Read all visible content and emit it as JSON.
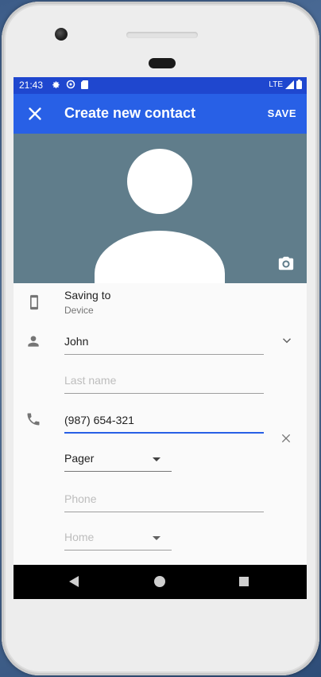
{
  "status_bar": {
    "time": "21:43",
    "network": "LTE",
    "icons": [
      "settings-icon",
      "sync-icon",
      "sd-card-icon",
      "signal-icon",
      "battery-icon"
    ]
  },
  "app_bar": {
    "title": "Create new contact",
    "save_label": "SAVE",
    "close_icon": "close-icon"
  },
  "photo": {
    "background_color": "#607d8b",
    "camera_icon": "camera-icon"
  },
  "saving_to": {
    "label": "Saving to",
    "account": "Device",
    "icon": "phone-device-icon"
  },
  "name": {
    "icon": "person-icon",
    "first_name_value": "John",
    "last_name_placeholder": "Last name",
    "expand_icon": "chevron-down-icon"
  },
  "phone": {
    "icon": "phone-icon",
    "value": "(987) 654-321",
    "type": "Pager",
    "clear_icon": "clear-icon",
    "new_phone_placeholder": "Phone",
    "new_phone_type": "Home"
  },
  "colors": {
    "status_bar": "#1f47cf",
    "app_bar": "#2860e6",
    "accent": "#2860e6"
  },
  "nav_bar": {
    "buttons": [
      "back-icon",
      "home-icon",
      "recents-icon"
    ]
  }
}
